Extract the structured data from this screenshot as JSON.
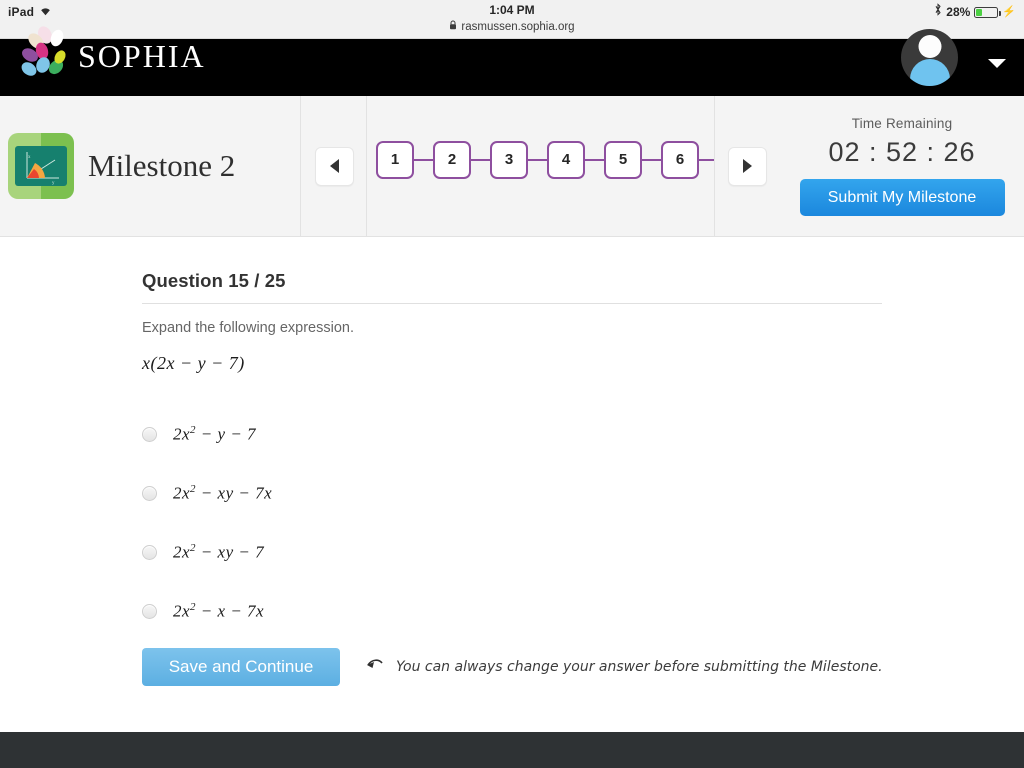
{
  "status_bar": {
    "device": "iPad",
    "wifi_icon": "wifi-icon",
    "time": "1:04 PM",
    "lock_icon": "lock-icon",
    "url": "rasmussen.sophia.org",
    "bluetooth_icon": "bluetooth-icon",
    "battery_percent": "28%",
    "battery_level": 28,
    "charging_icon": "lightning-bolt-icon"
  },
  "site_nav": {
    "brand": "SOPHIA",
    "logo_icon": "sophia-petals-logo",
    "avatar_icon": "user-avatar",
    "caret_icon": "chevron-down-icon"
  },
  "milestone_bar": {
    "course_icon": "graph-chalkboard-icon",
    "title": "Milestone 2",
    "prev_label": "prev-question-arrow",
    "next_label": "next-question-arrow",
    "questions": [
      "1",
      "2",
      "3",
      "4",
      "5",
      "6"
    ],
    "timer_label": "Time Remaining",
    "timer_value": "02 : 52 : 26",
    "submit_label": "Submit My Milestone",
    "accent_purple": "#8e4f9f",
    "accent_blue": "#1b87dd"
  },
  "question": {
    "heading": "Question 15 / 25",
    "prompt": "Expand the following expression.",
    "expression": "x(2x − y − 7)",
    "choices": [
      {
        "base": "2x",
        "exp": "2",
        "rest": " − y − 7"
      },
      {
        "base": "2x",
        "exp": "2",
        "rest": " − xy − 7x"
      },
      {
        "base": "2x",
        "exp": "2",
        "rest": " − xy − 7"
      },
      {
        "base": "2x",
        "exp": "2",
        "rest": " − x − 7x"
      }
    ]
  },
  "actions": {
    "save_label": "Save and Continue",
    "hint_icon": "curved-back-arrow-icon",
    "hint_text": "You can always change your answer before submitting the Milestone."
  }
}
